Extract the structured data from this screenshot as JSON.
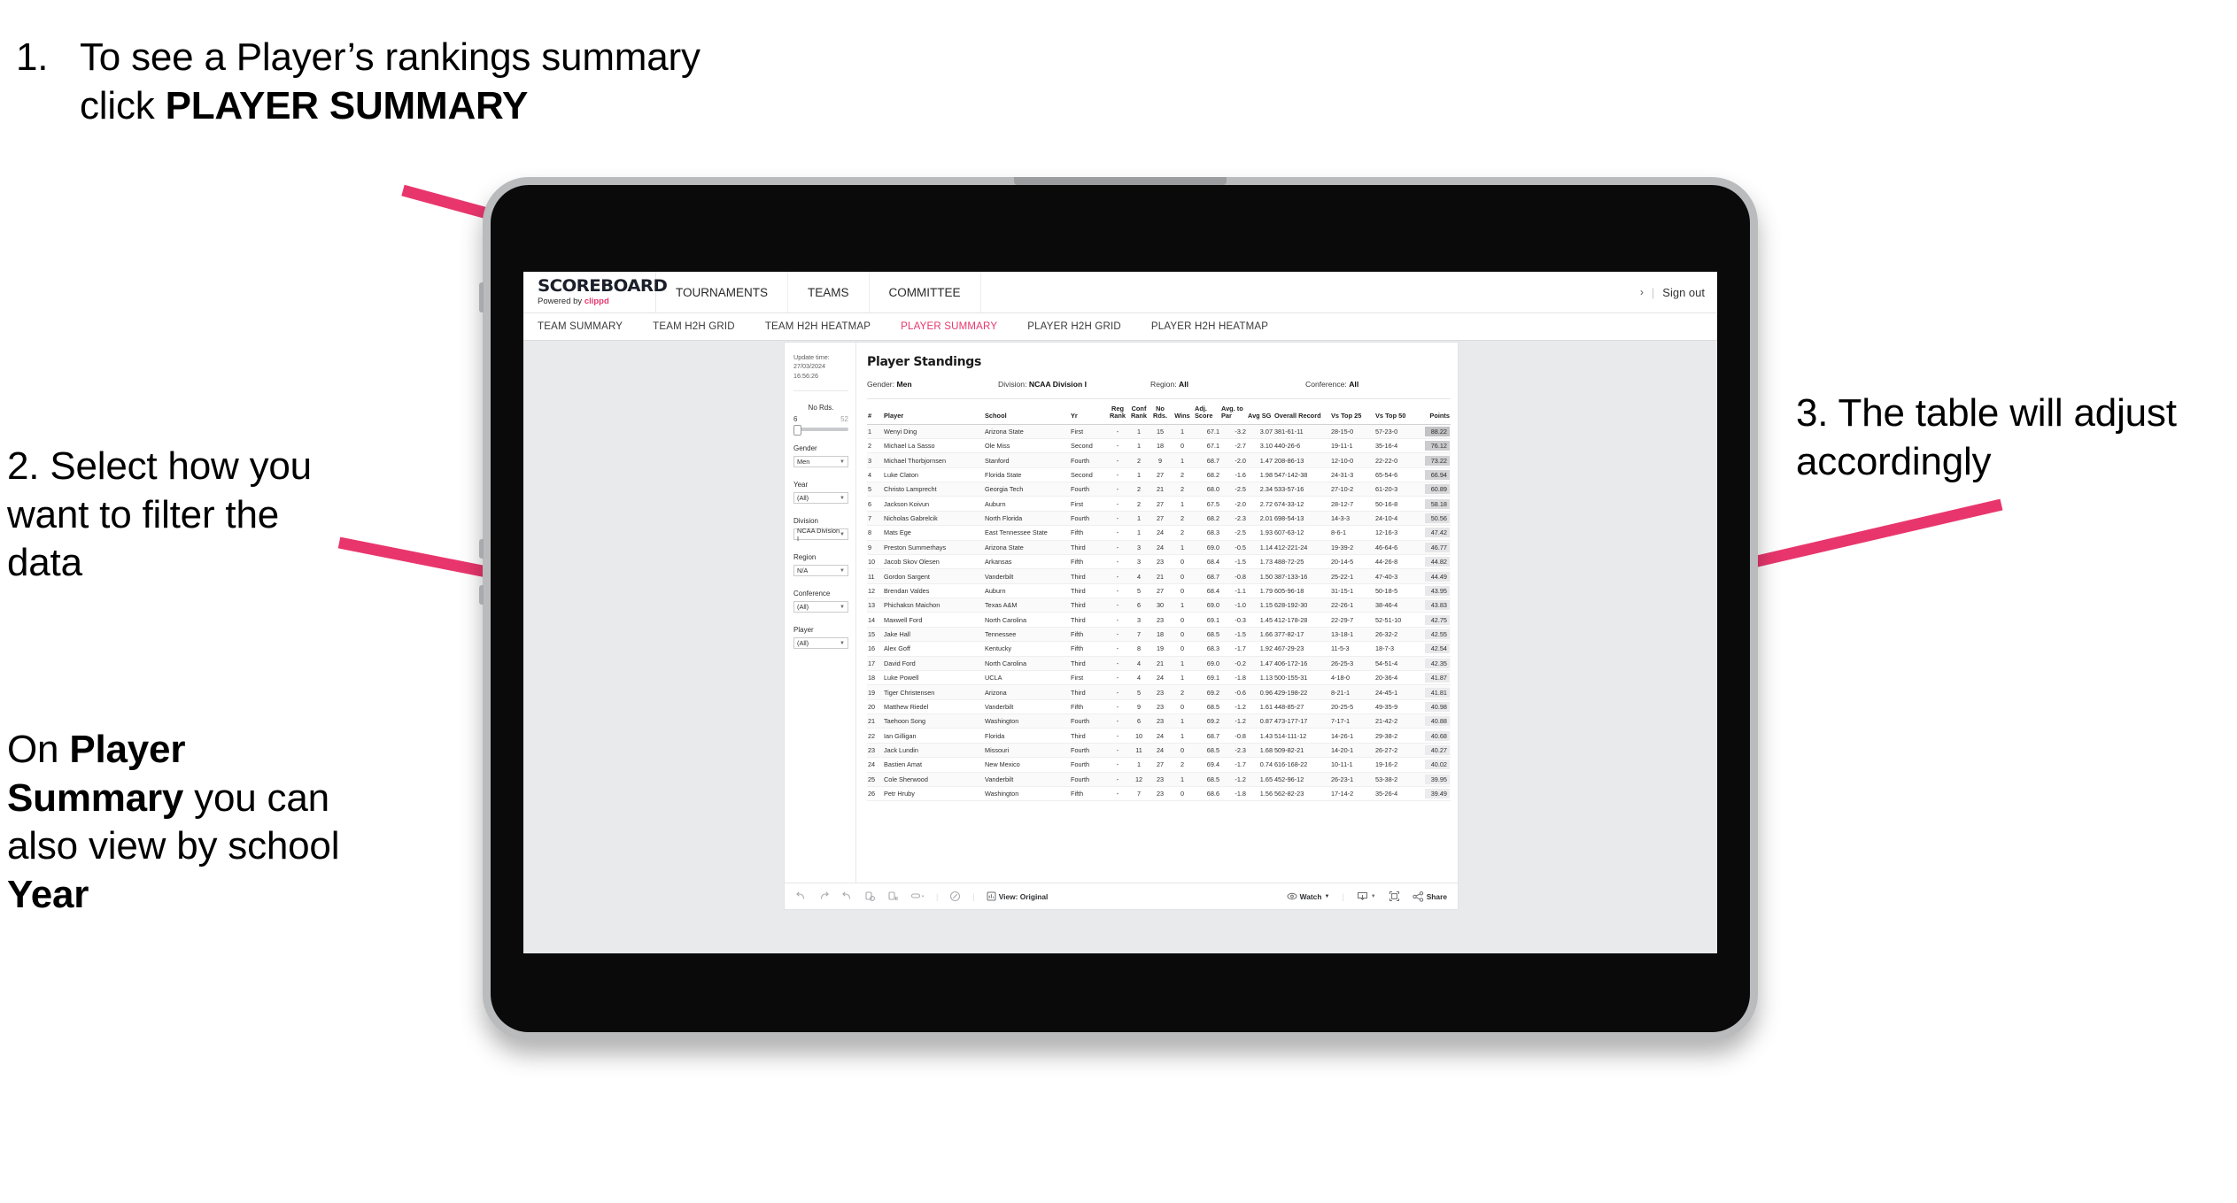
{
  "annotations": {
    "step1": {
      "num": "1.",
      "text_before": "To see a Player’s rankings summary click ",
      "bold": "PLAYER SUMMARY"
    },
    "step2": {
      "text": "2. Select how you want to filter the data"
    },
    "step2b": {
      "p1": "On ",
      "b1": "Player Summary",
      "p2": " you can also view by school ",
      "b2": "Year"
    },
    "step3": {
      "text": "3. The table will adjust accordingly"
    },
    "arrow_color": "#e8366d"
  },
  "app": {
    "brand": {
      "name": "SCOREBOARD",
      "powered_prefix": "Powered by ",
      "powered_brand": "clippd"
    },
    "top_nav": [
      "TOURNAMENTS",
      "TEAMS",
      "COMMITTEE"
    ],
    "sign_out": "Sign out",
    "sub_nav": [
      {
        "label": "TEAM SUMMARY",
        "active": false
      },
      {
        "label": "TEAM H2H GRID",
        "active": false
      },
      {
        "label": "TEAM H2H HEATMAP",
        "active": false
      },
      {
        "label": "PLAYER SUMMARY",
        "active": true
      },
      {
        "label": "PLAYER H2H GRID",
        "active": false
      },
      {
        "label": "PLAYER H2H HEATMAP",
        "active": false
      }
    ],
    "accent": "#e8366d"
  },
  "dashboard": {
    "update_time_label": "Update time:",
    "update_time_value": "27/03/2024 16:56:26",
    "title": "Player Standings",
    "meta": [
      {
        "label": "Gender: ",
        "value": "Men"
      },
      {
        "label": "Division: ",
        "value": "NCAA Division I"
      },
      {
        "label": "Region: ",
        "value": "All"
      },
      {
        "label": "Conference: ",
        "value": "All"
      }
    ],
    "filters": {
      "slider": {
        "label": "No Rds.",
        "min": "6",
        "max": "52"
      },
      "selects": [
        {
          "label": "Gender",
          "value": "Men"
        },
        {
          "label": "Year",
          "value": "(All)"
        },
        {
          "label": "Division",
          "value": "NCAA Division I"
        },
        {
          "label": "Region",
          "value": "N/A"
        },
        {
          "label": "Conference",
          "value": "(All)"
        },
        {
          "label": "Player",
          "value": "(All)"
        }
      ]
    },
    "toolbar": {
      "view_label": "View: Original",
      "watch_label": "Watch",
      "share_label": "Share"
    }
  },
  "table": {
    "headers": [
      "#",
      "Player",
      "School",
      "Yr",
      "Reg Rank",
      "Conf Rank",
      "No Rds.",
      "Wins",
      "Adj. Score",
      "Avg. to Par",
      "Avg SG",
      "Overall Record",
      "Vs Top 25",
      "Vs Top 50",
      "Points"
    ],
    "rows": [
      [
        "1",
        "Wenyi Ding",
        "Arizona State",
        "First",
        "-",
        "1",
        "15",
        "1",
        "67.1",
        "-3.2",
        "3.07",
        "381-61-11",
        "28-15-0",
        "57-23-0",
        "88.22"
      ],
      [
        "2",
        "Michael La Sasso",
        "Ole Miss",
        "Second",
        "-",
        "1",
        "18",
        "0",
        "67.1",
        "-2.7",
        "3.10",
        "440-26-6",
        "19-11-1",
        "35-16-4",
        "76.12"
      ],
      [
        "3",
        "Michael Thorbjornsen",
        "Stanford",
        "Fourth",
        "-",
        "2",
        "9",
        "1",
        "68.7",
        "-2.0",
        "1.47",
        "208-86-13",
        "12-10-0",
        "22-22-0",
        "73.22"
      ],
      [
        "4",
        "Luke Claton",
        "Florida State",
        "Second",
        "-",
        "1",
        "27",
        "2",
        "68.2",
        "-1.6",
        "1.98",
        "547-142-38",
        "24-31-3",
        "65-54-6",
        "66.94"
      ],
      [
        "5",
        "Christo Lamprecht",
        "Georgia Tech",
        "Fourth",
        "-",
        "2",
        "21",
        "2",
        "68.0",
        "-2.5",
        "2.34",
        "533-57-16",
        "27-10-2",
        "61-20-3",
        "60.89"
      ],
      [
        "6",
        "Jackson Koivun",
        "Auburn",
        "First",
        "-",
        "2",
        "27",
        "1",
        "67.5",
        "-2.0",
        "2.72",
        "674-33-12",
        "28-12-7",
        "50-16-8",
        "58.18"
      ],
      [
        "7",
        "Nicholas Gabrelcik",
        "North Florida",
        "Fourth",
        "-",
        "1",
        "27",
        "2",
        "68.2",
        "-2.3",
        "2.01",
        "698-54-13",
        "14-3-3",
        "24-10-4",
        "50.56"
      ],
      [
        "8",
        "Mats Ege",
        "East Tennessee State",
        "Fifth",
        "-",
        "1",
        "24",
        "2",
        "68.3",
        "-2.5",
        "1.93",
        "607-63-12",
        "8-6-1",
        "12-16-3",
        "47.42"
      ],
      [
        "9",
        "Preston Summerhays",
        "Arizona State",
        "Third",
        "-",
        "3",
        "24",
        "1",
        "69.0",
        "-0.5",
        "1.14",
        "412-221-24",
        "19-39-2",
        "46-64-6",
        "46.77"
      ],
      [
        "10",
        "Jacob Skov Olesen",
        "Arkansas",
        "Fifth",
        "-",
        "3",
        "23",
        "0",
        "68.4",
        "-1.5",
        "1.73",
        "488-72-25",
        "20-14-5",
        "44-26-8",
        "44.82"
      ],
      [
        "11",
        "Gordon Sargent",
        "Vanderbilt",
        "Third",
        "-",
        "4",
        "21",
        "0",
        "68.7",
        "-0.8",
        "1.50",
        "387-133-16",
        "25-22-1",
        "47-40-3",
        "44.49"
      ],
      [
        "12",
        "Brendan Valdes",
        "Auburn",
        "Third",
        "-",
        "5",
        "27",
        "0",
        "68.4",
        "-1.1",
        "1.79",
        "605-96-18",
        "31-15-1",
        "50-18-5",
        "43.95"
      ],
      [
        "13",
        "Phichaksn Maichon",
        "Texas A&M",
        "Third",
        "-",
        "6",
        "30",
        "1",
        "69.0",
        "-1.0",
        "1.15",
        "628-192-30",
        "22-26-1",
        "38-46-4",
        "43.83"
      ],
      [
        "14",
        "Maxwell Ford",
        "North Carolina",
        "Third",
        "-",
        "3",
        "23",
        "0",
        "69.1",
        "-0.3",
        "1.45",
        "412-178-28",
        "22-29-7",
        "52-51-10",
        "42.75"
      ],
      [
        "15",
        "Jake Hall",
        "Tennessee",
        "Fifth",
        "-",
        "7",
        "18",
        "0",
        "68.5",
        "-1.5",
        "1.66",
        "377-82-17",
        "13-18-1",
        "26-32-2",
        "42.55"
      ],
      [
        "16",
        "Alex Goff",
        "Kentucky",
        "Fifth",
        "-",
        "8",
        "19",
        "0",
        "68.3",
        "-1.7",
        "1.92",
        "467-29-23",
        "11-5-3",
        "18-7-3",
        "42.54"
      ],
      [
        "17",
        "David Ford",
        "North Carolina",
        "Third",
        "-",
        "4",
        "21",
        "1",
        "69.0",
        "-0.2",
        "1.47",
        "406-172-16",
        "26-25-3",
        "54-51-4",
        "42.35"
      ],
      [
        "18",
        "Luke Powell",
        "UCLA",
        "First",
        "-",
        "4",
        "24",
        "1",
        "69.1",
        "-1.8",
        "1.13",
        "500-155-31",
        "4-18-0",
        "20-36-4",
        "41.87"
      ],
      [
        "19",
        "Tiger Christensen",
        "Arizona",
        "Third",
        "-",
        "5",
        "23",
        "2",
        "69.2",
        "-0.6",
        "0.96",
        "429-198-22",
        "8-21-1",
        "24-45-1",
        "41.81"
      ],
      [
        "20",
        "Matthew Riedel",
        "Vanderbilt",
        "Fifth",
        "-",
        "9",
        "23",
        "0",
        "68.5",
        "-1.2",
        "1.61",
        "448-85-27",
        "20-25-5",
        "49-35-9",
        "40.98"
      ],
      [
        "21",
        "Taehoon Song",
        "Washington",
        "Fourth",
        "-",
        "6",
        "23",
        "1",
        "69.2",
        "-1.2",
        "0.87",
        "473-177-17",
        "7-17-1",
        "21-42-2",
        "40.88"
      ],
      [
        "22",
        "Ian Gilligan",
        "Florida",
        "Third",
        "-",
        "10",
        "24",
        "1",
        "68.7",
        "-0.8",
        "1.43",
        "514-111-12",
        "14-26-1",
        "29-38-2",
        "40.68"
      ],
      [
        "23",
        "Jack Lundin",
        "Missouri",
        "Fourth",
        "-",
        "11",
        "24",
        "0",
        "68.5",
        "-2.3",
        "1.68",
        "509-82-21",
        "14-20-1",
        "26-27-2",
        "40.27"
      ],
      [
        "24",
        "Bastien Amat",
        "New Mexico",
        "Fourth",
        "-",
        "1",
        "27",
        "2",
        "69.4",
        "-1.7",
        "0.74",
        "616-168-22",
        "10-11-1",
        "19-16-2",
        "40.02"
      ],
      [
        "25",
        "Cole Sherwood",
        "Vanderbilt",
        "Fourth",
        "-",
        "12",
        "23",
        "1",
        "68.5",
        "-1.2",
        "1.65",
        "452-96-12",
        "26-23-1",
        "53-38-2",
        "39.95"
      ],
      [
        "26",
        "Petr Hruby",
        "Washington",
        "Fifth",
        "-",
        "7",
        "23",
        "0",
        "68.6",
        "-1.8",
        "1.56",
        "562-82-23",
        "17-14-2",
        "35-26-4",
        "39.49"
      ]
    ]
  }
}
